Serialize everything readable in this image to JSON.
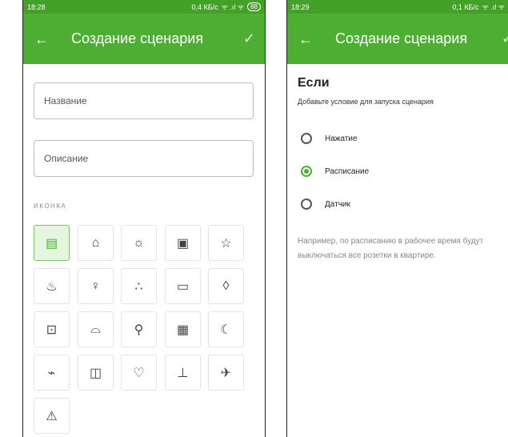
{
  "screen1": {
    "status": {
      "time": "18:28",
      "net": "0,4 КБ/с",
      "signal": "ᯤ .ıl ᯤ",
      "battery": "88"
    },
    "appbar": {
      "back": "←",
      "title": "Создание сценария",
      "confirm": "✓"
    },
    "name_placeholder": "Название",
    "description_placeholder": "Описание",
    "icon_section_label": "ИКОНКА",
    "icons": [
      {
        "name": "document-icon",
        "glyph": "▤",
        "selected": true
      },
      {
        "name": "home-icon",
        "glyph": "⌂"
      },
      {
        "name": "sun-icon",
        "glyph": "☼"
      },
      {
        "name": "outlet-icon",
        "glyph": "▣"
      },
      {
        "name": "star-icon",
        "glyph": "☆"
      },
      {
        "name": "fire-icon",
        "glyph": "♨"
      },
      {
        "name": "wine-glass-icon",
        "glyph": "♀"
      },
      {
        "name": "drops-icon",
        "glyph": "∴"
      },
      {
        "name": "clapperboard-icon",
        "glyph": "▭"
      },
      {
        "name": "water-drop-icon",
        "glyph": "◊"
      },
      {
        "name": "lock-icon",
        "glyph": "⊡"
      },
      {
        "name": "sunrise-icon",
        "glyph": "⌓"
      },
      {
        "name": "running-man-icon",
        "glyph": "⚲"
      },
      {
        "name": "film-icon",
        "glyph": "▦"
      },
      {
        "name": "moon-icon",
        "glyph": "☾"
      },
      {
        "name": "plug-icon",
        "glyph": "⌁"
      },
      {
        "name": "door-icon",
        "glyph": "◫"
      },
      {
        "name": "heart-icon",
        "glyph": "♡"
      },
      {
        "name": "thermometer-icon",
        "glyph": "⊥"
      },
      {
        "name": "airplane-icon",
        "glyph": "✈"
      },
      {
        "name": "warning-icon",
        "glyph": "⚠"
      }
    ]
  },
  "screen2": {
    "status": {
      "time": "18:29",
      "net": "0,1 КБ/с",
      "signal": "ᯤ .ıl ᯤ"
    },
    "appbar": {
      "back": "←",
      "title": "Создание сценария",
      "confirm": "✓"
    },
    "if_title": "Если",
    "if_subtitle": "Добавьте условие для запуска сценария",
    "options": [
      {
        "label": "Нажатие",
        "checked": false
      },
      {
        "label": "Расписание",
        "checked": true
      },
      {
        "label": "Датчик",
        "checked": false
      }
    ],
    "hint": "Например, по расписанию в рабочее время будут выключаться все розетки в квартире."
  },
  "colors": {
    "primary": "#4caf32",
    "status_bar": "#43a128",
    "selected_tile_bg": "#e5f5df"
  }
}
